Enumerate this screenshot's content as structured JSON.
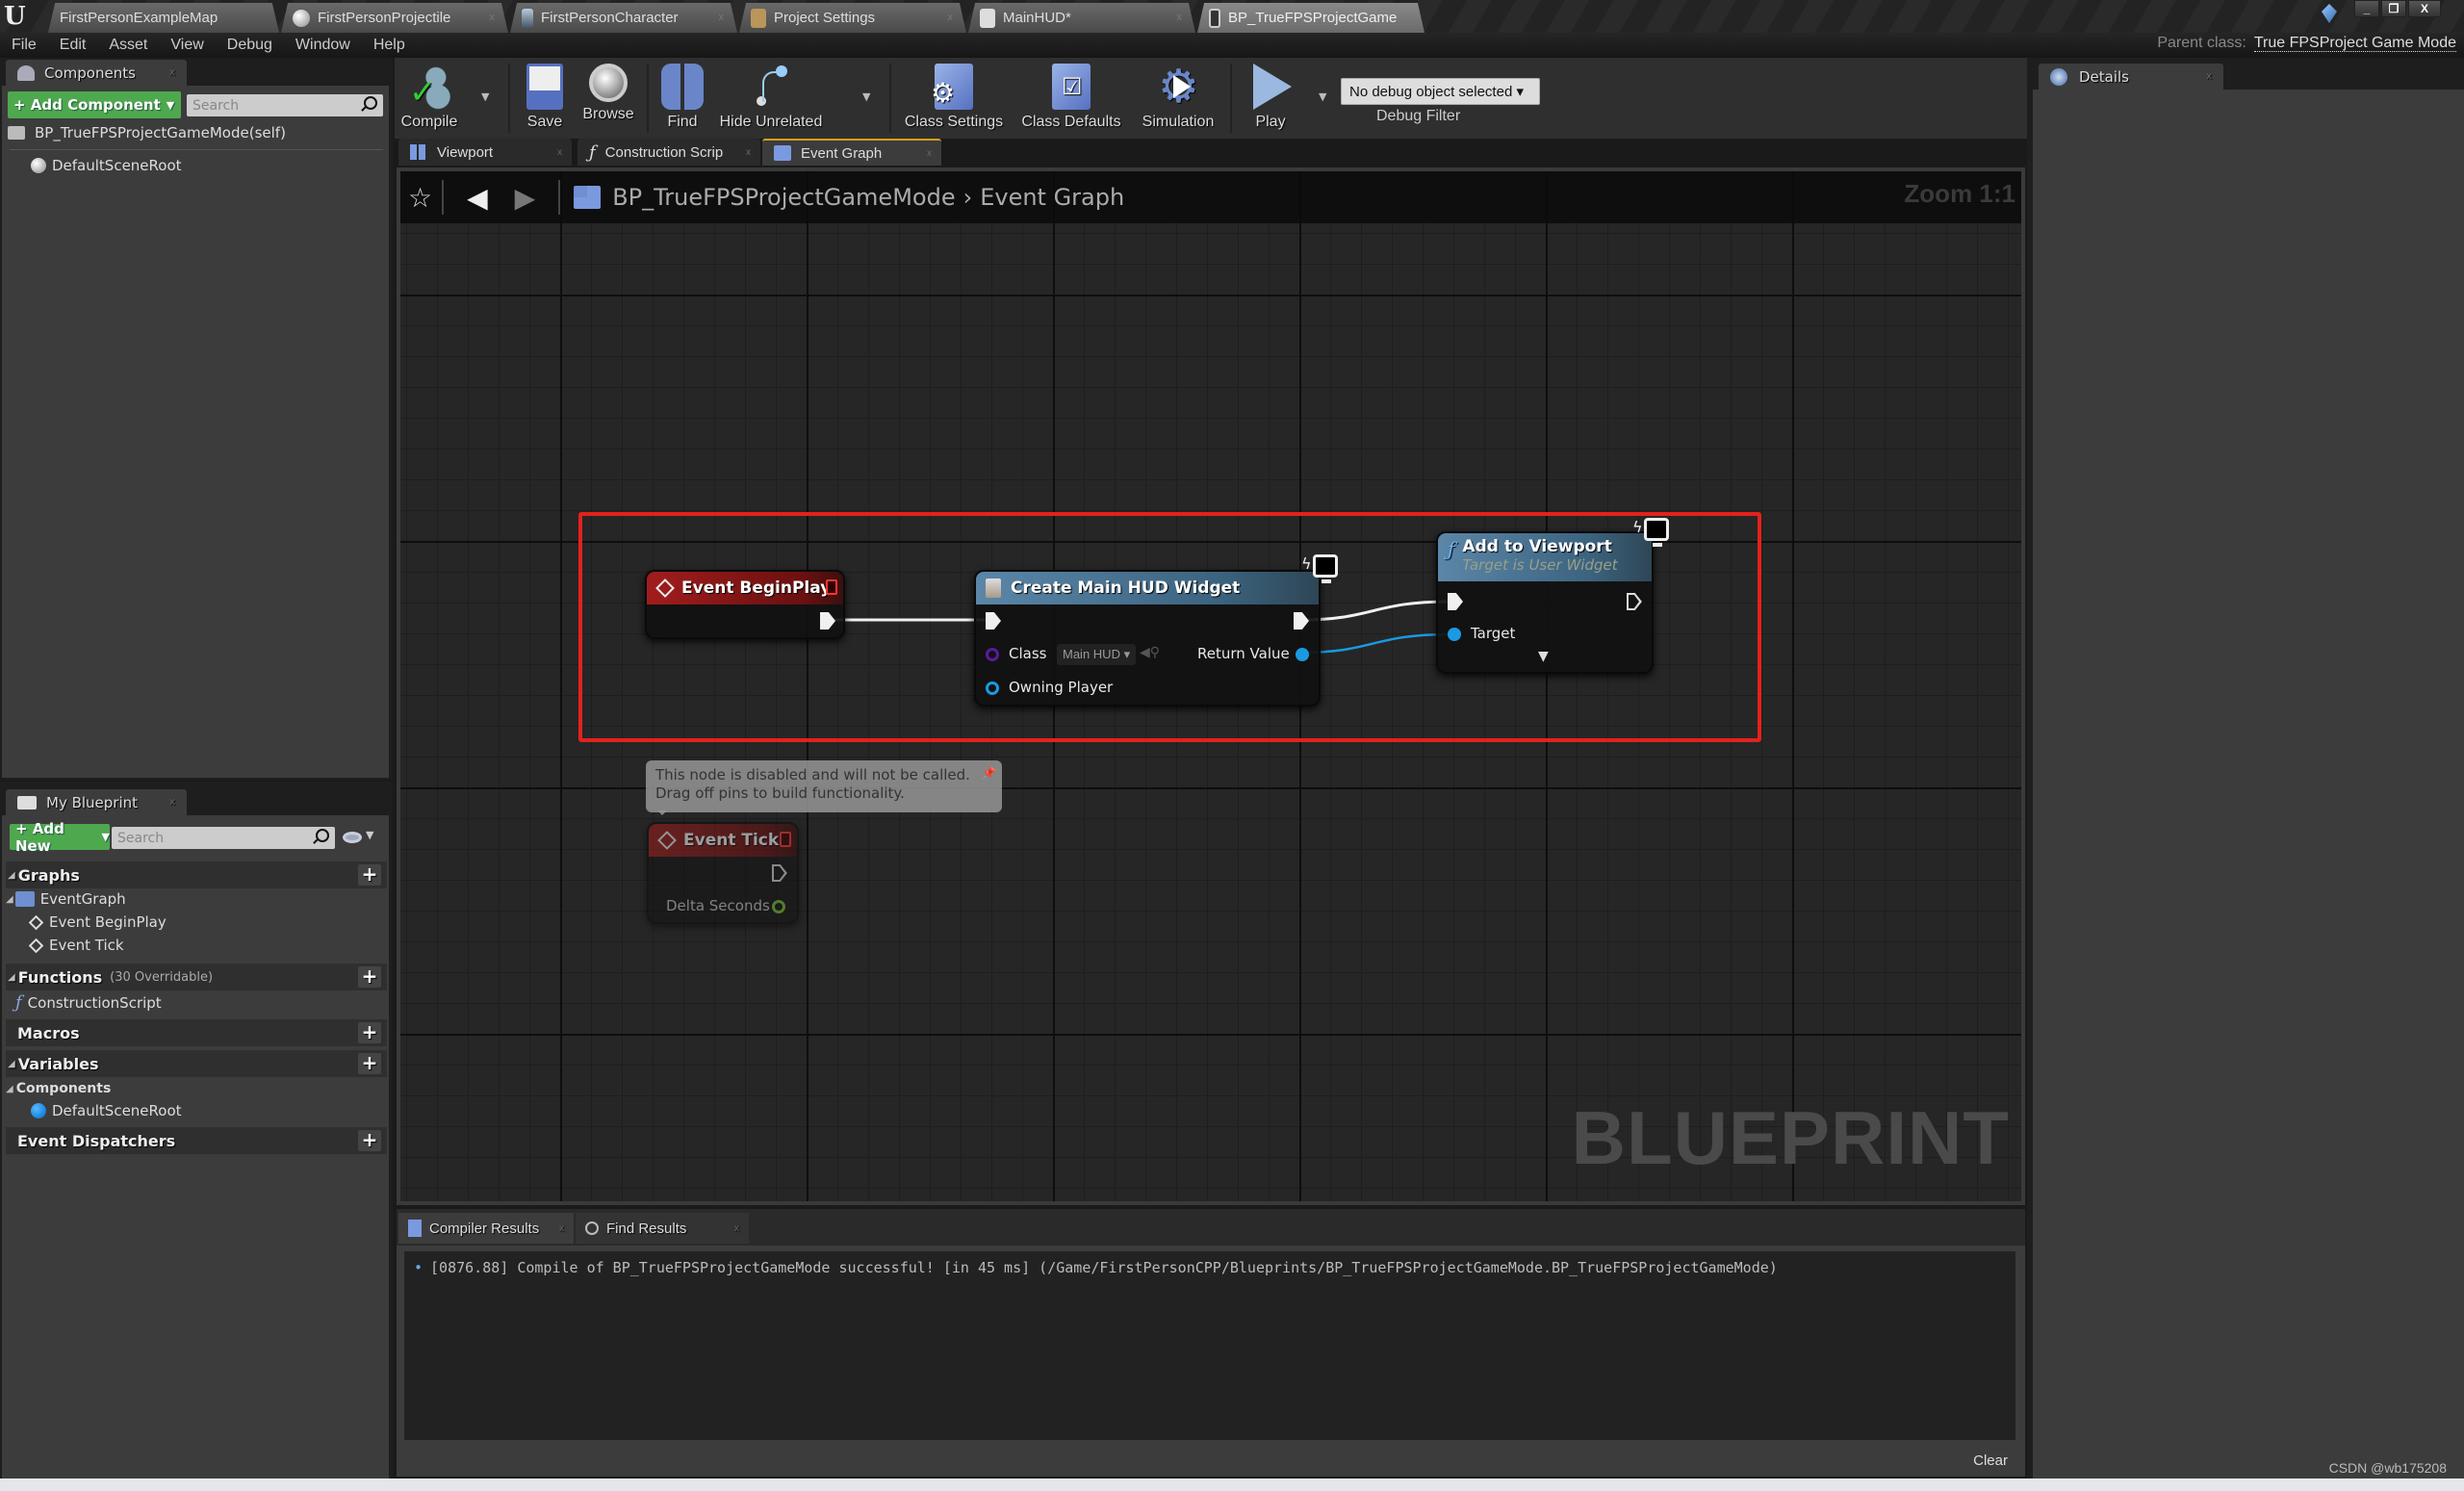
{
  "window": {
    "tabs": [
      {
        "label": "FirstPersonExampleMap",
        "icon": "map-icon",
        "active": false
      },
      {
        "label": "FirstPersonProjectile",
        "icon": "sphere-icon",
        "active": false
      },
      {
        "label": "FirstPersonCharacter",
        "icon": "character-icon",
        "active": false
      },
      {
        "label": "Project Settings",
        "icon": "settings-folder-icon",
        "active": false
      },
      {
        "label": "MainHUD*",
        "icon": "widget-blueprint-icon",
        "active": false
      },
      {
        "label": "BP_TrueFPSProjectGame",
        "icon": "blueprint-icon",
        "active": true
      }
    ],
    "controls": {
      "minimize": "_",
      "restore": "❐",
      "close": "X"
    }
  },
  "menu": [
    "File",
    "Edit",
    "Asset",
    "View",
    "Debug",
    "Window",
    "Help"
  ],
  "parent_class": {
    "label": "Parent class:",
    "value": "True FPSProject Game Mode"
  },
  "components_panel": {
    "tab_label": "Components",
    "add_button": "+ Add Component",
    "search_placeholder": "Search",
    "self_item": "BP_TrueFPSProjectGameMode(self)",
    "items": [
      "DefaultSceneRoot"
    ]
  },
  "toolbar": {
    "compile": "Compile",
    "save": "Save",
    "browse": "Browse",
    "find": "Find",
    "hide_unrelated": "Hide Unrelated",
    "class_settings": "Class Settings",
    "class_defaults": "Class Defaults",
    "simulation": "Simulation",
    "play": "Play",
    "debug_select": "No debug object selected ▾",
    "debug_filter": "Debug Filter"
  },
  "graph_tabs": [
    {
      "label": "Viewport",
      "active": false
    },
    {
      "label": "Construction Scrip",
      "active": false
    },
    {
      "label": "Event Graph",
      "active": true
    }
  ],
  "graph": {
    "breadcrumb": [
      "BP_TrueFPSProjectGameMode",
      "Event Graph"
    ],
    "zoom": "Zoom 1:1",
    "watermark": "BLUEPRINT",
    "nodes": {
      "begin_play": {
        "title": "Event BeginPlay"
      },
      "create_widget": {
        "title": "Create Main HUD Widget",
        "pins": {
          "class": "Class",
          "class_value": "Main HUD ▾",
          "owning_player": "Owning Player",
          "return_value": "Return Value"
        }
      },
      "add_to_viewport": {
        "title": "Add to Viewport",
        "subtitle": "Target is User Widget",
        "pins": {
          "target": "Target"
        }
      },
      "event_tick": {
        "title": "Event Tick",
        "pins": {
          "delta_seconds": "Delta Seconds"
        },
        "disabled": true
      }
    },
    "comment": [
      "This node is disabled and will not be called.",
      "Drag off pins to build functionality."
    ],
    "colors": {
      "highlight_box": "#e3221c",
      "exec_wire": "#f0f0f0",
      "object_wire": "#1a9ae0",
      "class_pin": "#5a1aa0",
      "float_pin": "#7cc23a"
    }
  },
  "my_blueprint": {
    "tab_label": "My Blueprint",
    "add_button": "+ Add New",
    "search_placeholder": "Search",
    "sections": {
      "graphs": "Graphs",
      "event_graph": "EventGraph",
      "event_begin_play": "Event BeginPlay",
      "event_tick": "Event Tick",
      "functions": "Functions",
      "functions_sub": "(30 Overridable)",
      "construction_script": "ConstructionScript",
      "macros": "Macros",
      "variables": "Variables",
      "components": "Components",
      "default_scene_root": "DefaultSceneRoot",
      "event_dispatchers": "Event Dispatchers"
    }
  },
  "bottom_panel": {
    "tabs": [
      "Compiler Results",
      "Find Results"
    ],
    "log": [
      "[0876.88] Compile of BP_TrueFPSProjectGameMode successful! [in 45 ms] (/Game/FirstPersonCPP/Blueprints/BP_TrueFPSProjectGameMode.BP_TrueFPSProjectGameMode)"
    ],
    "clear": "Clear"
  },
  "details_panel": {
    "tab_label": "Details"
  },
  "credit": "CSDN @wb175208"
}
